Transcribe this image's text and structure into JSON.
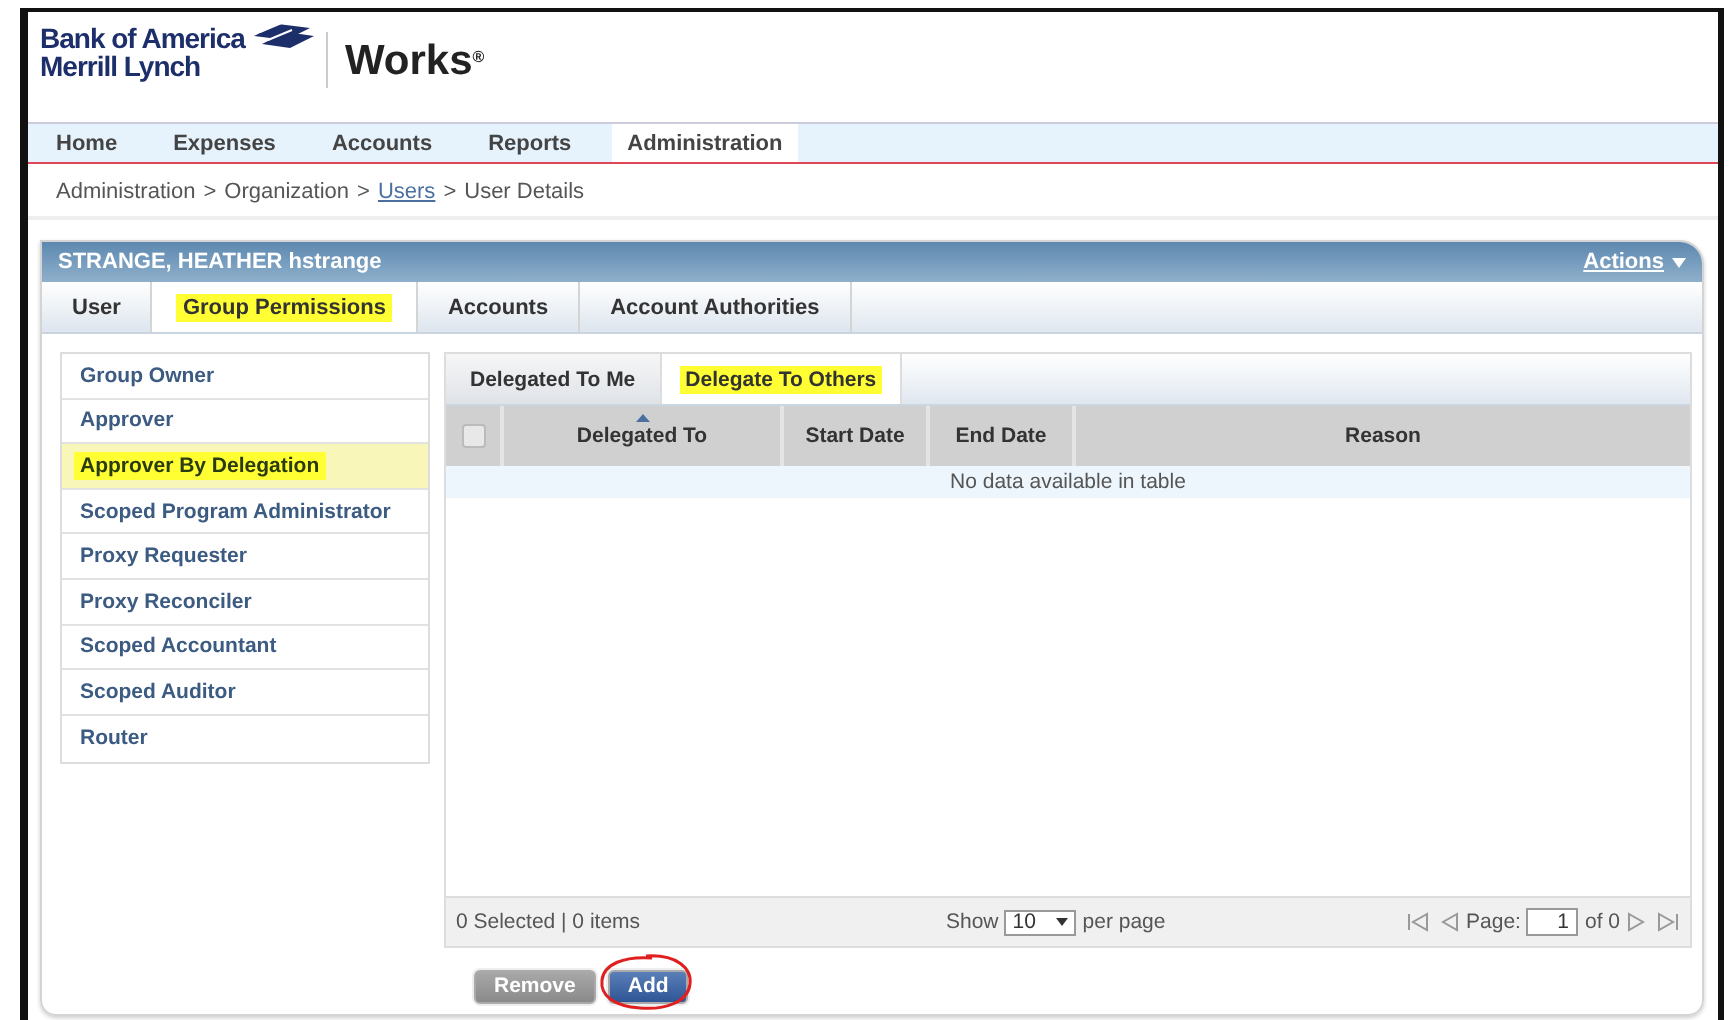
{
  "logo": {
    "line1": "Bank of America",
    "line2": "Merrill Lynch",
    "product": "Works$^{®}$"
  },
  "nav": [
    {
      "label": "Home",
      "selected": false
    },
    {
      "label": "Expenses",
      "selected": false
    },
    {
      "label": "Accounts",
      "selected": false
    },
    {
      "label": "Reports",
      "selected": false
    },
    {
      "label": "Administration",
      "selected": true
    }
  ],
  "breadcrumb": [
    {
      "label": "Administration",
      "link": false
    },
    {
      "label": "Organization",
      "link": false
    },
    {
      "label": "Users",
      "link": true
    },
    {
      "label": "User Details",
      "link": false
    }
  ],
  "breadcrumb_separator": ">",
  "panel": {
    "title": "STRANGE, HEATHER hstrange",
    "actions": "Actions"
  },
  "tabs": [
    {
      "label": "User",
      "selected": false,
      "highlighted": false
    },
    {
      "label": "Group Permissions",
      "selected": true,
      "highlighted": true
    },
    {
      "label": "Accounts",
      "selected": false,
      "highlighted": false
    },
    {
      "label": "Account Authorities",
      "selected": false,
      "highlighted": false
    }
  ],
  "groups": [
    {
      "label": "Group Owner",
      "selected": false,
      "highlighted": false
    },
    {
      "label": "Approver",
      "selected": false,
      "highlighted": false
    },
    {
      "label": "Approver By Delegation",
      "selected": true,
      "highlighted": true
    },
    {
      "label": "Scoped Program Administrator",
      "selected": false,
      "highlighted": false
    },
    {
      "label": "Proxy Requester",
      "selected": false,
      "highlighted": false
    },
    {
      "label": "Proxy Reconciler",
      "selected": false,
      "highlighted": false
    },
    {
      "label": "Scoped Accountant",
      "selected": false,
      "highlighted": false
    },
    {
      "label": "Scoped Auditor",
      "selected": false,
      "highlighted": false
    },
    {
      "label": "Router",
      "selected": false,
      "highlighted": false
    }
  ],
  "subtabs": [
    {
      "label": "Delegated To Me",
      "selected": false,
      "highlighted": false
    },
    {
      "label": "Delegate To Others",
      "selected": true,
      "highlighted": true
    }
  ],
  "table": {
    "select_all": {
      "checked": false
    },
    "columns": [
      {
        "kind": "checkbox"
      },
      {
        "kind": "text",
        "label": "Delegated To",
        "sorted": true
      },
      {
        "kind": "text",
        "label": "Start Date",
        "sorted": false
      },
      {
        "kind": "text",
        "label": "End Date",
        "sorted": false
      },
      {
        "kind": "text",
        "label": "Reason",
        "sorted": false
      }
    ],
    "empty_message": "No data available in table"
  },
  "footer": {
    "selection": "0 Selected | 0 items",
    "show": "Show",
    "page_size": "10",
    "per_page": "per page",
    "page_label": "Page:",
    "page": "1",
    "page_total": "of 0"
  },
  "buttons": [
    {
      "label": "Remove",
      "kind": "secondary",
      "circled": false
    },
    {
      "label": "Add",
      "kind": "primary",
      "circled": true
    }
  ]
}
